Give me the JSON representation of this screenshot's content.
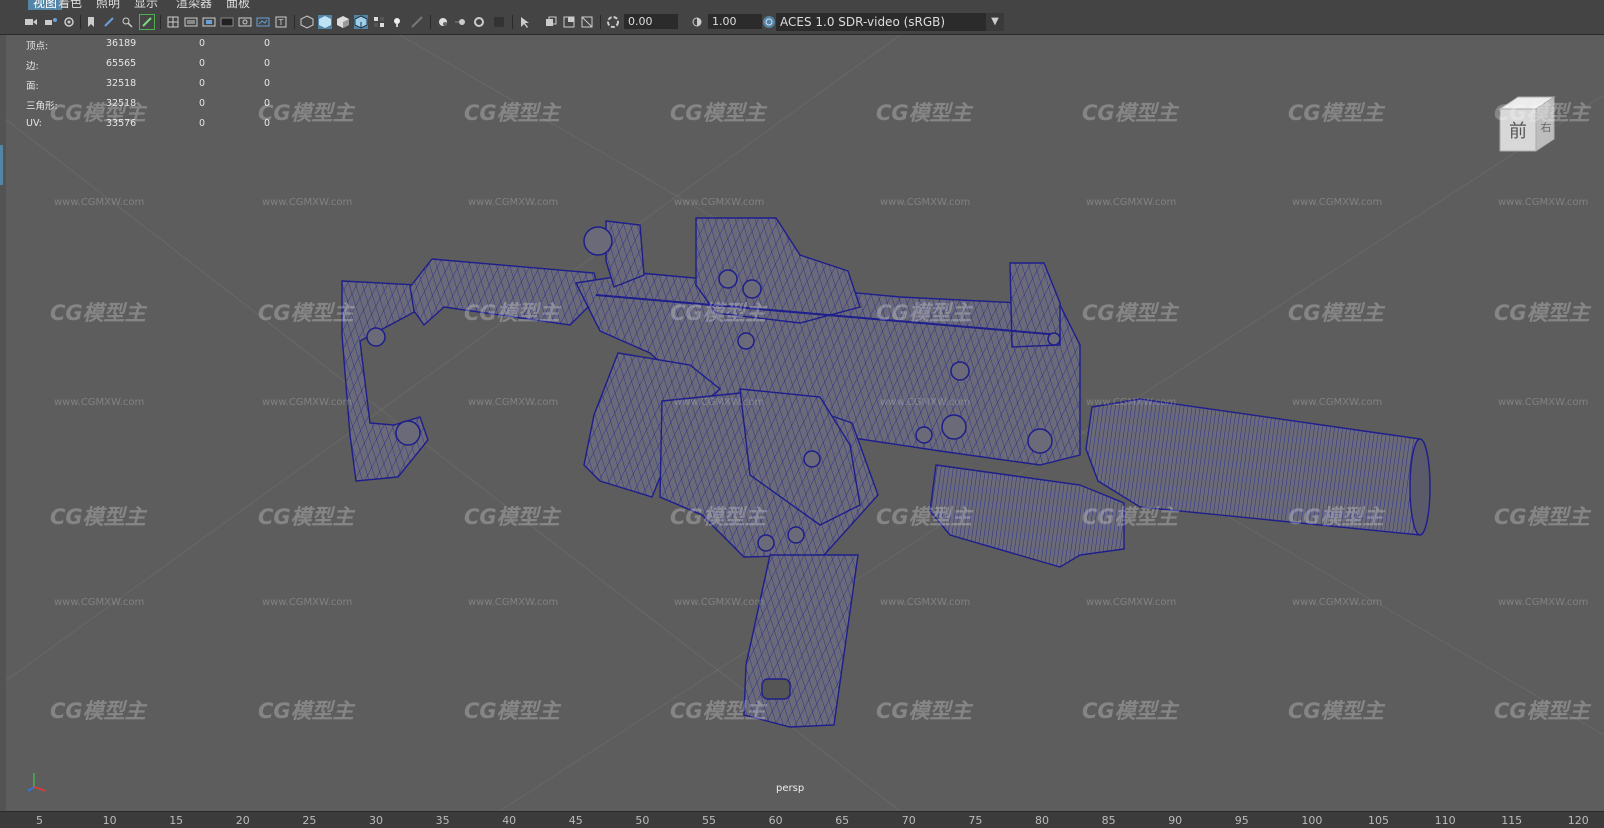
{
  "menu": [
    {
      "label": "视图",
      "active": true
    },
    {
      "label": "着色",
      "active": false
    },
    {
      "label": "照明",
      "active": false
    },
    {
      "label": "显示",
      "active": false
    },
    {
      "label": "渲染器",
      "active": false
    },
    {
      "label": "面板",
      "active": false
    }
  ],
  "toolbar": {
    "exposure": "0.00",
    "gamma": "1.00",
    "color_space": "ACES 1.0 SDR-video (sRGB)",
    "color_space_icon": "color-management-icon"
  },
  "hud": {
    "rows": [
      {
        "label": "顶点:",
        "v1": "36189",
        "v2": "0",
        "v3": "0"
      },
      {
        "label": "边:",
        "v1": "65565",
        "v2": "0",
        "v3": "0"
      },
      {
        "label": "面:",
        "v1": "32518",
        "v2": "0",
        "v3": "0"
      },
      {
        "label": "三角形:",
        "v1": "32518",
        "v2": "0",
        "v3": "0"
      },
      {
        "label": "UV:",
        "v1": "33576",
        "v2": "0",
        "v3": "0"
      }
    ]
  },
  "viewcube": {
    "front_label": "前",
    "right_label": "右"
  },
  "camera_label": "persp",
  "watermark": {
    "logo": "CG模型主",
    "url": "www.CGMXW.com"
  },
  "ruler": [
    "5",
    "10",
    "15",
    "20",
    "25",
    "30",
    "35",
    "40",
    "45",
    "50",
    "55",
    "60",
    "65",
    "70",
    "75",
    "80",
    "85",
    "90",
    "95",
    "100",
    "105",
    "110",
    "115",
    "120"
  ],
  "colors": {
    "wire": "#1e1e8c",
    "mesh": "#6a6a78",
    "viewport_bg": "#5d5d5d",
    "highlight": "#5285a6"
  }
}
